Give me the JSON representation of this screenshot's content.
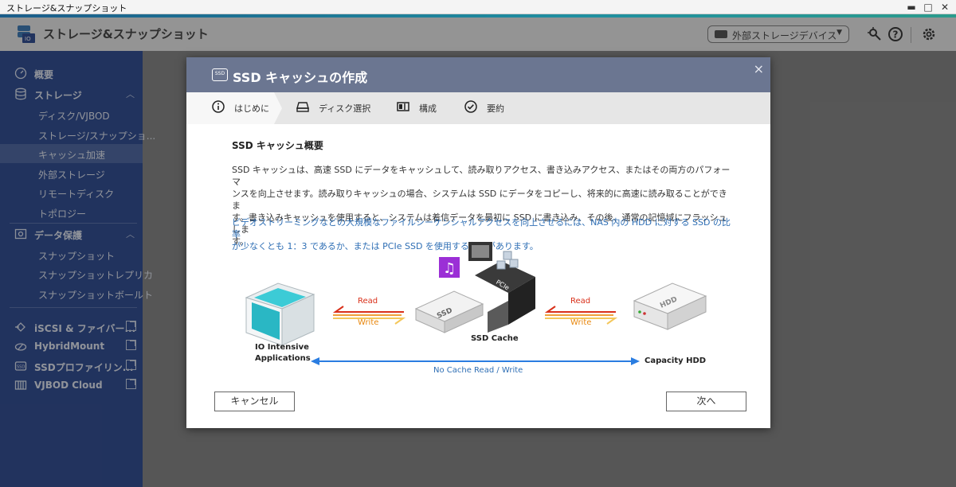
{
  "window": {
    "title": "ストレージ&スナップショット",
    "minimize": "▬",
    "maximize": "□",
    "close": "✕"
  },
  "app": {
    "title": "ストレージ&スナップショット",
    "external_devices_label": "外部ストレージデバイス"
  },
  "sidebar": {
    "items": [
      {
        "label": "概要",
        "icon": "gauge-icon"
      },
      {
        "label": "ストレージ",
        "icon": "database-icon"
      },
      {
        "label": "ディスク/VJBOD"
      },
      {
        "label": "ストレージ/スナップショ..."
      },
      {
        "label": "キャッシュ加速"
      },
      {
        "label": "外部ストレージ"
      },
      {
        "label": "リモートディスク"
      },
      {
        "label": "トポロジー"
      },
      {
        "label": "データ保護",
        "icon": "data-protection-icon"
      },
      {
        "label": "スナップショット"
      },
      {
        "label": "スナップショットレプリカ"
      },
      {
        "label": "スナップショットボールト"
      },
      {
        "label": "iSCSI & ファイバー...",
        "icon": "iscsi-icon"
      },
      {
        "label": "HybridMount",
        "icon": "hybridmount-icon"
      },
      {
        "label": "SSDプロファイリン...",
        "icon": "ssd-profiling-icon"
      },
      {
        "label": "VJBOD Cloud",
        "icon": "vjbod-cloud-icon"
      }
    ]
  },
  "dialog": {
    "title": "SSD キャッシュの作成",
    "close": "×",
    "steps": [
      {
        "label": "はじめに",
        "active": true
      },
      {
        "label": "ディスク選択"
      },
      {
        "label": "構成"
      },
      {
        "label": "要約"
      }
    ],
    "section_title": "SSD キャッシュ概要",
    "para_lines": [
      "SSD キャッシュは、高速 SSD にデータをキャッシュして、読み取りアクセス、書き込みアクセス、またはその両方のパフォーマ",
      "ンスを向上させます。読み取りキャッシュの場合、システムは SSD にデータをコピーし、将来的に高速に読み取ることができま",
      "す。書き込みキャッシュを使用すると、システムは着信データを最初に SSD に書き込み、その後、通常の記憶域にフラッシュしま",
      "す。"
    ],
    "blue_lines": [
      "ビデオストリーミングなどの大規模なファイルシーケンシャルアクセスを向上させるには、NAS 内の HDD に対する SSD の比率",
      "が少なくとも 1：3 であるか、または PCIe SSD を使用する必要があります。"
    ],
    "diagram": {
      "read_left": "Read",
      "write_left": "Write",
      "read_right": "Read",
      "write_right": "Write",
      "apps_line1": "IO Intensive",
      "apps_line2": "Applications",
      "ssd_cache": "SSD Cache",
      "capacity_hdd": "Capacity HDD",
      "no_cache": "No Cache Read / Write",
      "ssd_text": "SSD",
      "pcie_text1": "PCIe",
      "pcie_text2": "SSD",
      "hdd_text": "HDD"
    },
    "cancel_label": "キャンセル",
    "next_label": "次へ"
  },
  "colors": {
    "sidebar_bg": "#1d3c8a",
    "sidebar_selected": "#3f5c9e",
    "dialog_header": "#6b7691",
    "read_color": "#d9301a",
    "write_color": "#e8870e",
    "arrow_blue": "#2a7de1",
    "link_blue": "#2f6fb5",
    "teal_box": "#2ab7c4"
  }
}
